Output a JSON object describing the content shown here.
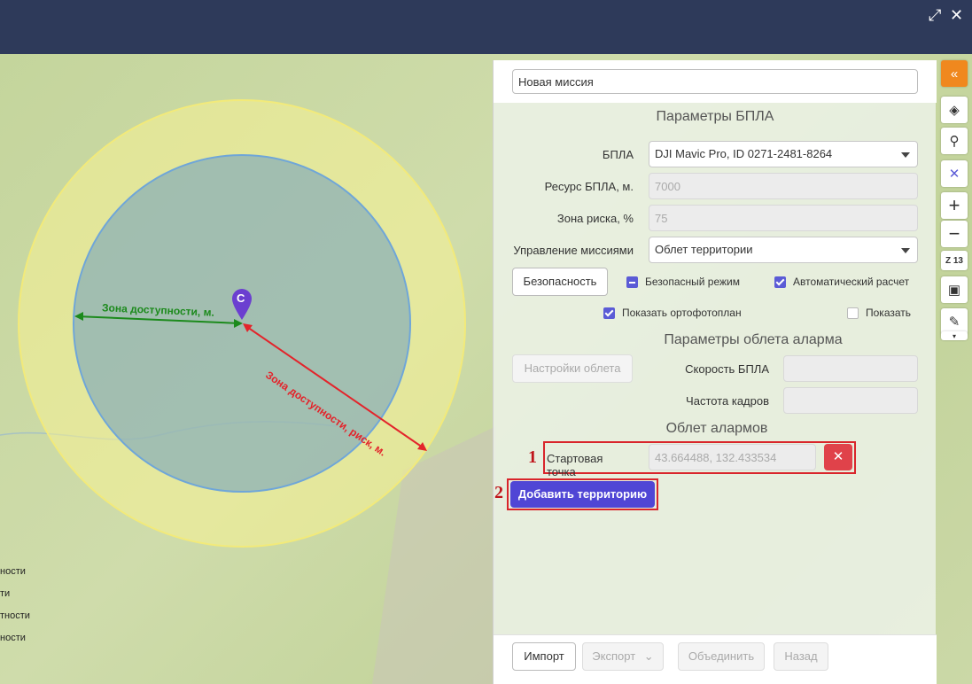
{
  "window": {
    "maximize_icon": "expand-icon",
    "close_icon": "close-icon"
  },
  "map": {
    "marker_label": "C",
    "line_green_label": "Зона доступности, м.",
    "line_red_label": "Зона доступности, риск, м.",
    "colors": {
      "inner_zone": "#6f9fc0",
      "outer_zone": "#f5f08f",
      "green_line": "#1c8a1c",
      "red_line": "#e3242b",
      "marker": "#6b3fd0"
    },
    "legend_items": [
      "ности",
      "ти",
      "тности",
      "ности"
    ]
  },
  "panel": {
    "mission_name": "Новая миссия",
    "uav_section_title": "Параметры БПЛА",
    "uav_label": "БПЛА",
    "uav_value": "DJI Mavic Pro, ID 0271-2481-8264",
    "resource_label": "Ресурс БПЛА, м.",
    "resource_value": "7000",
    "risk_label": "Зона риска, %",
    "risk_value": "75",
    "mission_control_label": "Управление миссиями",
    "mission_control_value": "Облет территории",
    "safety_button": "Безопасность",
    "safe_mode_label": "Безопасный режим",
    "auto_calc_label": "Автоматический расчет",
    "show_orthophoto_label": "Показать ортофотоплан",
    "show_label": "Показать",
    "alarm_section_title": "Параметры облета аларма",
    "flight_settings_button": "Настройки облета",
    "speed_label": "Скорость БПЛА",
    "frame_rate_label": "Частота кадров",
    "alarms_section_title": "Облет алармов",
    "start_point_label": "Стартовая точка",
    "start_point_value": "43.664488, 132.433534",
    "clear_icon": "close-icon",
    "add_territory_button": "Добавить территорию",
    "annotation_1": "1",
    "annotation_2": "2",
    "footer": {
      "import": "Импорт",
      "export": "Экспорт",
      "merge": "Объединить",
      "back": "Назад"
    }
  },
  "toolbar": {
    "collapse_icon": "double-chevron-left-icon",
    "layers_icon": "layers-icon",
    "search_icon": "search-icon",
    "drone_icon": "drone-icon",
    "zoom_in_icon": "plus-icon",
    "zoom_out_icon": "minus-icon",
    "zoom_level": "Z 13",
    "save_icon": "save-icon",
    "settings_icon": "wrench-icon",
    "more_icon": "chevron-down-icon"
  }
}
